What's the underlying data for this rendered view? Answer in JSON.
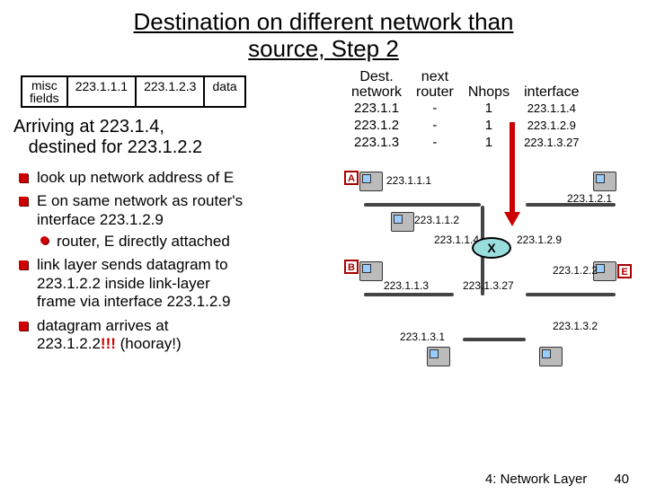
{
  "title_line1": "Destination on different network than",
  "title_line2": "source, Step 2",
  "packet": {
    "misc1": "misc",
    "misc2": "fields",
    "src": "223.1.1.1",
    "dst": "223.1.2.3",
    "data": "data"
  },
  "statement_l1": "Arriving at 223.1.4,",
  "statement_l2": "destined for 223.1.2.2",
  "bullets": {
    "b1": "look up network address of E",
    "b2_l1": "E on same network as router's",
    "b2_l2": "interface 223.1.2.9",
    "b2_sub": "router, E directly attached",
    "b3_l1": "link layer sends datagram to",
    "b3_l2": "223.1.2.2 inside link-layer",
    "b3_l3": "frame via interface 223.1.2.9",
    "b4_l1": "datagram arrives at",
    "b4_l2a": "223.1.2.2",
    "b4_l2b": "!!!",
    "b4_l2c": " (hooray!)"
  },
  "chart_data": {
    "type": "table",
    "headers": {
      "c1a": "Dest.",
      "c1b": "network",
      "c2a": "next",
      "c2b": "router",
      "c3": "Nhops",
      "c4": "interface"
    },
    "rows": [
      {
        "net": "223.1.1",
        "next": "-",
        "nhops": "1",
        "iface": "223.1.1.4"
      },
      {
        "net": "223.1.2",
        "next": "-",
        "nhops": "1",
        "iface": "223.1.2.9"
      },
      {
        "net": "223.1.3",
        "next": "-",
        "nhops": "1",
        "iface": "223.1.3.27"
      }
    ]
  },
  "ip": {
    "a": "223.1.1.1",
    "b": "223.1.1.2",
    "c": "223.1.1.3",
    "r1": "223.1.1.4",
    "r2": "223.1.2.9",
    "r3": "223.1.3.27",
    "d": "223.1.2.1",
    "e": "223.1.2.2",
    "f": "223.1.3.1",
    "g": "223.1.3.2"
  },
  "tags": {
    "A": "A",
    "B": "B",
    "E": "E"
  },
  "router_x": "X",
  "footer": {
    "section": "4: Network Layer",
    "page": "40"
  }
}
